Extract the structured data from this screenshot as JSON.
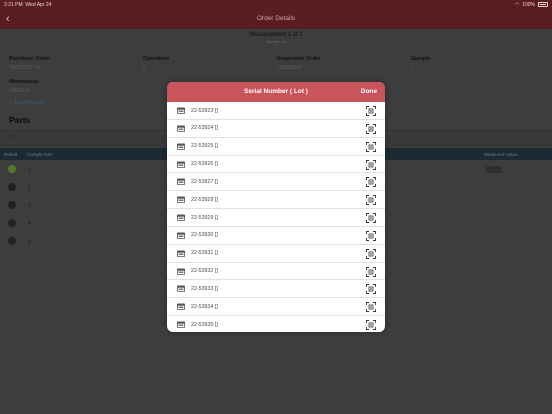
{
  "status_bar": {
    "time": "2:21 PM",
    "date": "Wed Apr 24",
    "battery": "100%"
  },
  "nav": {
    "title": "Order Details",
    "back_icon": "chevron-left-icon"
  },
  "measurement": {
    "title": "Measurement 1 of 1",
    "subtitle": "Sample 1/1"
  },
  "info": {
    "po_label": "Purchase Order",
    "po_value": "SA000091 LA",
    "op_label": "Operation",
    "op_value": "0",
    "io_label": "Inspection Order",
    "io_value": "100000046",
    "sample_label": "Sample",
    "sample_value": "1",
    "wh_label": "Warehouse",
    "wh_value": "MARZUK",
    "attachments": "Attachments"
  },
  "parts": {
    "heading": "Parts",
    "col_result": "Result",
    "col_sample_part": "Sample Part",
    "col_measured_value": "Measured Value",
    "rows": [
      {
        "num": "1",
        "status": "ok",
        "value": "6 unit"
      },
      {
        "num": "2",
        "status": "pending",
        "value": ""
      },
      {
        "num": "3",
        "status": "pending",
        "value": ""
      },
      {
        "num": "4",
        "status": "pending",
        "value": ""
      },
      {
        "num": "5",
        "status": "pending",
        "value": ""
      }
    ]
  },
  "modal": {
    "title": "Serial Number ( Lot )",
    "done_label": "Done",
    "header_color": "#c8555c",
    "items": [
      "22-53923 []",
      "22-53924 []",
      "22-53925 []",
      "22-53926 []",
      "22-53927 []",
      "22-53928 []",
      "22-53929 []",
      "22-53930 []",
      "22-53931 []",
      "22-53932 []",
      "22-53933 []",
      "22-53934 []",
      "22-53935 []"
    ]
  }
}
